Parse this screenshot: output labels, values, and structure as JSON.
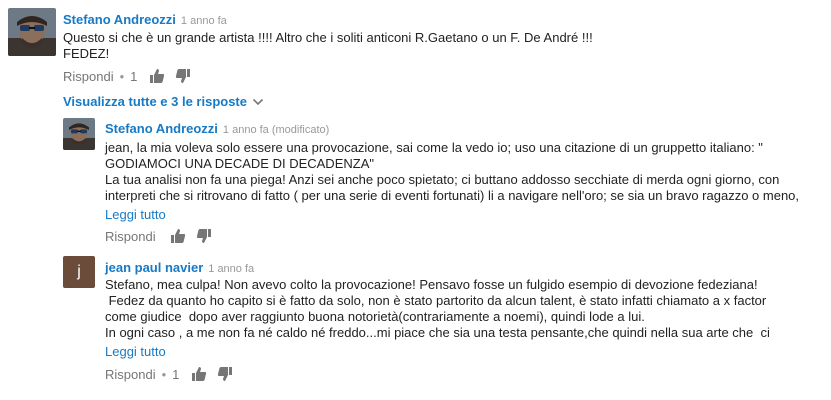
{
  "comment1": {
    "author": "Stefano Andreozzi",
    "time": "1 anno fa",
    "lines": [
      "Questo si che è un grande artista !!!! Altro che i soliti anticoni R.Gaetano o un F. De André !!!",
      "FEDEZ!"
    ],
    "reply_label": "Rispondi",
    "likes": "1"
  },
  "view_replies": "Visualizza tutte e 3 le risposte",
  "reply1": {
    "author": "Stefano Andreozzi",
    "time": "1 anno fa (modificato)",
    "lines": [
      "jean, la mia voleva solo essere una provocazione, sai come la vedo io; uso una citazione di un gruppetto italiano: \"",
      "GODIAMOCI UNA DECADE DI DECADENZA\"",
      "La tua analisi non fa una piega! Anzi sei anche poco spietato; ci buttano addosso secchiate di merda ogni giorno, con",
      "interpreti che si ritrovano di fatto ( per una serie di eventi fortunati) li a navigare nell'oro; se sia un bravo ragazzo o meno,"
    ],
    "read_more": "Leggi tutto",
    "reply_label": "Rispondi"
  },
  "reply2": {
    "author": "jean paul navier",
    "time": "1 anno fa",
    "avatar_letter": "j",
    "lines": [
      "Stefano, mea culpa! Non avevo colto la provocazione! Pensavo fosse un fulgido esempio di devozione fedeziana!",
      " Fedez da quanto ho capito si è fatto da solo, non è stato partorito da alcun talent, è stato infatti chiamato a x factor",
      "come giudice  dopo aver raggiunto buona notorietà(contrariamente a noemi), quindi lode a lui.",
      "In ogni caso , a me non fa né caldo né freddo...mi piace che sia una testa pensante,che quindi nella sua arte che  ci"
    ],
    "read_more": "Leggi tutto",
    "reply_label": "Rispondi",
    "likes": "1"
  },
  "colors": {
    "link": "#167ac6",
    "meta": "#999999",
    "text": "#222222",
    "action": "#767676",
    "avatar_letter_bg": "#6b4b3a"
  },
  "icons": [
    "thumbs-up-icon",
    "thumbs-down-icon",
    "chevron-down-icon"
  ]
}
